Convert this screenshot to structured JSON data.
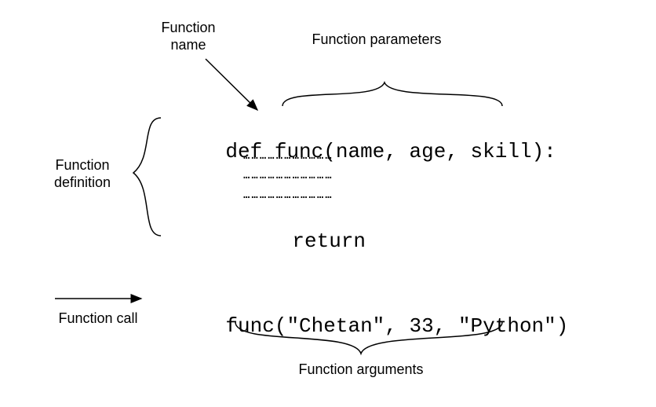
{
  "labels": {
    "function_name": "Function\nname",
    "function_parameters": "Function parameters",
    "function_definition": "Function\ndefinition",
    "function_call": "Function call",
    "function_arguments": "Function arguments"
  },
  "code": {
    "def_keyword": "def",
    "function_name": "func",
    "params_open": "(",
    "param1": "name",
    "param_sep1": ", ",
    "param2": "age",
    "param_sep2": ", ",
    "param3": "skill",
    "params_close": "):",
    "body_dots": "……………………………",
    "return_keyword": "return",
    "call_name": "func",
    "call_open": "(",
    "arg1": "\"Chetan\"",
    "arg_sep1": ", ",
    "arg2": "33",
    "arg_sep2": ", ",
    "arg3": "\"Python\"",
    "call_close": ")"
  }
}
